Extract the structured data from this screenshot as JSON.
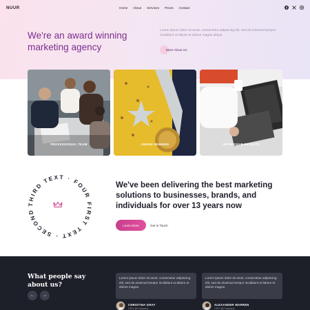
{
  "header": {
    "logo": "NUUR",
    "nav": [
      "Home",
      "About",
      "Services",
      "Prices",
      "Contact"
    ],
    "socials": [
      "facebook-icon",
      "x-icon",
      "instagram-icon"
    ]
  },
  "hero": {
    "title_line1": "We're an award winning",
    "title_line2": "marketing agency",
    "text": "Lorem ipsum dolor sit amet, consectetur adipiscing elit, sed do eiusmod tempor incididunt ut labore et dolore magna aliqua",
    "button": "More About Us"
  },
  "cards": [
    {
      "label": "PROFESSIONAL TEAM"
    },
    {
      "label": "AWARD WINNING"
    },
    {
      "label": "IMPRESSIVE RESULTS"
    }
  ],
  "middle": {
    "circle_text": "THIRD TEXT · FOUR FIRST TEXT · SECOND TEXT · ",
    "title": "We've been delivering the best marketing solutions to businesses, brands, and individuals for over 13 years now",
    "learn_more": "Learn More",
    "get_in_touch": "Get in Touch"
  },
  "testimonials": {
    "title": "What people say about us?",
    "prev": "←",
    "next": "→",
    "items": [
      {
        "quote": "Lorem ipsum dolor sit amet, consectetur adipiscing elit, sed do eiusmod tempor incididunt ut labore et dolore magna",
        "name": "CHRISTINA GRAY",
        "role": "CEO @Company"
      },
      {
        "quote": "Lorem ipsum dolor sit amet, consectetur adipiscing elit, sed do eiusmod tempor incididunt ut labore et dolore magna",
        "name": "ALEXANDER WARREN",
        "role": "CEO @Company"
      }
    ]
  },
  "colors": {
    "accent": "#7b2d8e",
    "button_gradient_start": "#c93f8c",
    "button_gradient_end": "#e0509e",
    "dark_bg": "#1d1f29"
  }
}
